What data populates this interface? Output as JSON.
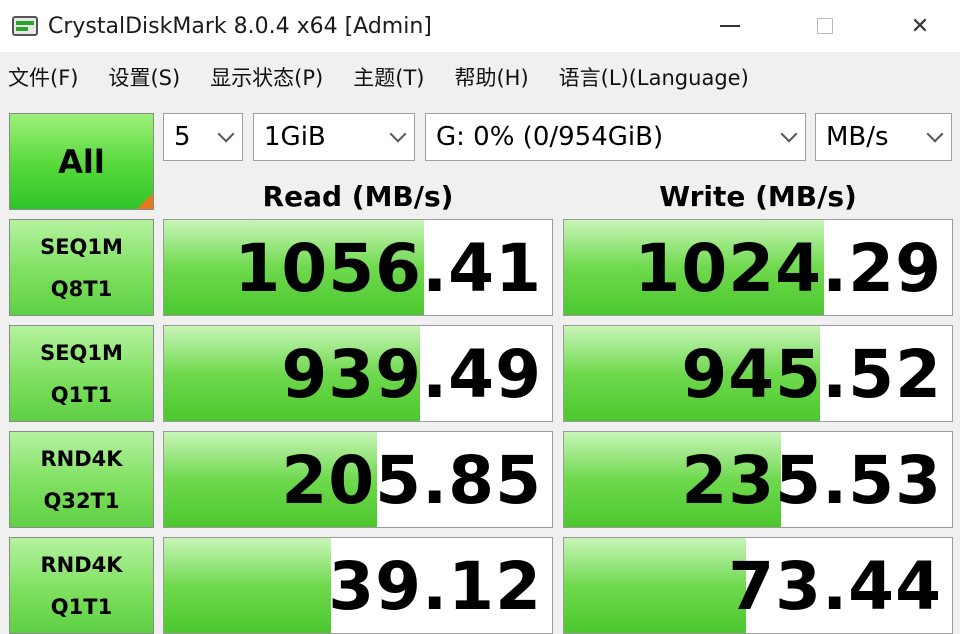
{
  "window": {
    "title": "CrystalDiskMark 8.0.4 x64 [Admin]",
    "app_icon": "disk-benchmark-icon",
    "minimize_icon": "minimize-icon",
    "maximize_icon": "maximize-icon",
    "close_icon": "close-icon"
  },
  "menu": [
    {
      "label": "文件(F)"
    },
    {
      "label": "设置(S)"
    },
    {
      "label": "显示状态(P)"
    },
    {
      "label": "主题(T)"
    },
    {
      "label": "帮助(H)"
    },
    {
      "label": "语言(L)(Language)"
    }
  ],
  "controls": {
    "all_label": "All",
    "test_count": "5",
    "test_size": "1GiB",
    "drive": "G: 0% (0/954GiB)",
    "unit": "MB/s"
  },
  "headers": {
    "read": "Read (MB/s)",
    "write": "Write (MB/s)"
  },
  "max_scale": 1700,
  "colors": {
    "accent_green": "#4cc82e",
    "corner_orange": "#e8781e"
  },
  "tests": [
    {
      "line1": "SEQ1M",
      "line2": "Q8T1",
      "read": "1056.41",
      "write": "1024.29",
      "read_fill": 0.67,
      "write_fill": 0.67
    },
    {
      "line1": "SEQ1M",
      "line2": "Q1T1",
      "read": "939.49",
      "write": "945.52",
      "read_fill": 0.66,
      "write_fill": 0.66
    },
    {
      "line1": "RND4K",
      "line2": "Q32T1",
      "read": "205.85",
      "write": "235.53",
      "read_fill": 0.55,
      "write_fill": 0.56
    },
    {
      "line1": "RND4K",
      "line2": "Q1T1",
      "read": "39.12",
      "write": "73.44",
      "read_fill": 0.43,
      "write_fill": 0.47
    }
  ]
}
